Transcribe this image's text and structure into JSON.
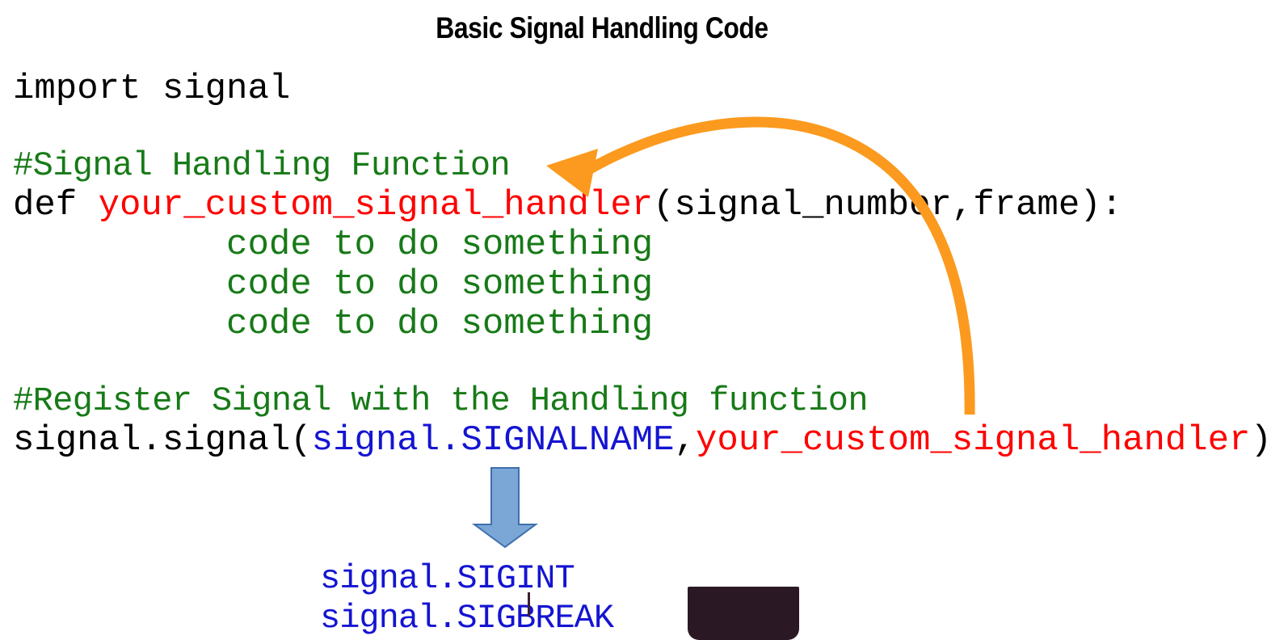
{
  "slide": {
    "title": "Basic Signal Handling Code"
  },
  "code": {
    "lines": [
      {
        "name": "import-line",
        "indent": 0,
        "tokens": [
          {
            "text": "import signal",
            "color": "black"
          }
        ]
      },
      {
        "name": "blank-1",
        "blank": true,
        "tokens": []
      },
      {
        "name": "comment-handler",
        "comment": true,
        "tokens": [
          {
            "text": "#Signal Handling Function",
            "color": "green"
          }
        ]
      },
      {
        "name": "def-line",
        "tokens": [
          {
            "text": "def ",
            "color": "black"
          },
          {
            "text": "your_custom_signal_handler",
            "color": "red"
          },
          {
            "text": "(signal_number,frame):",
            "color": "black"
          }
        ]
      },
      {
        "name": "body-line-1",
        "tokens": [
          {
            "text": "          code to do something",
            "color": "green"
          }
        ]
      },
      {
        "name": "body-line-2",
        "tokens": [
          {
            "text": "          code to do something",
            "color": "green"
          }
        ]
      },
      {
        "name": "body-line-3",
        "tokens": [
          {
            "text": "          code to do something",
            "color": "green"
          }
        ]
      },
      {
        "name": "blank-2",
        "blank": true,
        "tokens": []
      },
      {
        "name": "comment-register",
        "comment": true,
        "tokens": [
          {
            "text": "#Register Signal with the Handling function",
            "color": "green"
          }
        ]
      },
      {
        "name": "register-line",
        "tokens": [
          {
            "text": "signal.signal(",
            "color": "black"
          },
          {
            "text": "signal.SIGNALNAME",
            "color": "blue"
          },
          {
            "text": ",",
            "color": "black"
          },
          {
            "text": "your_custom_signal_handler",
            "color": "red"
          },
          {
            "text": ")",
            "color": "black"
          }
        ]
      }
    ]
  },
  "signal_examples": {
    "items": [
      "signal.SIGINT",
      "signal.SIGBREAK"
    ]
  },
  "annotations": {
    "orange_arrow": {
      "label": "curved-arrow-from-register-line-to-handler-definition",
      "color": "#fb9a1e"
    },
    "blue_arrow": {
      "label": "down-arrow-to-signal-examples",
      "fill": "#7ba7d7",
      "stroke": "#3f6fac"
    },
    "dark_block": {
      "label": "redacted-block",
      "color": "#2b1825"
    }
  },
  "colors": {
    "black": "#000000",
    "green": "#177a17",
    "red": "#ff0000",
    "blue": "#1414d2",
    "orange": "#fb9a1e"
  }
}
